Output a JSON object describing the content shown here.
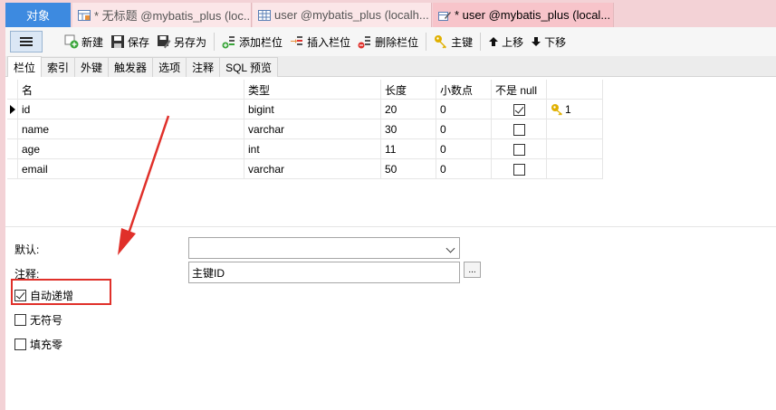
{
  "tabs": [
    {
      "label": "对象"
    },
    {
      "label": "* 无标题 @mybatis_plus (loc..."
    },
    {
      "label": "user @mybatis_plus (localh..."
    },
    {
      "label": "* user @mybatis_plus (local..."
    }
  ],
  "toolbar": {
    "new": "新建",
    "save": "保存",
    "save_as": "另存为",
    "add_field": "添加栏位",
    "insert_field": "插入栏位",
    "delete_field": "删除栏位",
    "primary_key": "主键",
    "move_up": "上移",
    "move_down": "下移"
  },
  "subtabs": [
    "栏位",
    "索引",
    "外键",
    "触发器",
    "选项",
    "注释",
    "SQL 预览"
  ],
  "grid": {
    "headers": {
      "name": "名",
      "type": "类型",
      "length": "长度",
      "decimals": "小数点",
      "not_null": "不是 null",
      "key": ""
    },
    "rows": [
      {
        "name": "id",
        "type": "bigint",
        "length": "20",
        "decimals": "0",
        "not_null": true,
        "key": "1"
      },
      {
        "name": "name",
        "type": "varchar",
        "length": "30",
        "decimals": "0",
        "not_null": false,
        "key": ""
      },
      {
        "name": "age",
        "type": "int",
        "length": "11",
        "decimals": "0",
        "not_null": false,
        "key": ""
      },
      {
        "name": "email",
        "type": "varchar",
        "length": "50",
        "decimals": "0",
        "not_null": false,
        "key": ""
      }
    ]
  },
  "properties": {
    "default_label": "默认:",
    "default_value": "",
    "comment_label": "注释:",
    "comment_value": "主键ID",
    "browse_button": "...",
    "auto_increment_label": "自动递增",
    "auto_increment": true,
    "unsigned_label": "无符号",
    "unsigned": false,
    "zerofill_label": "填充零",
    "zerofill": false
  },
  "colors": {
    "tab_strip": "#f3d2d6",
    "active_object_tab": "#3d8ae0",
    "annotation_red": "#e0302a",
    "key_icon": "#e0b000"
  }
}
